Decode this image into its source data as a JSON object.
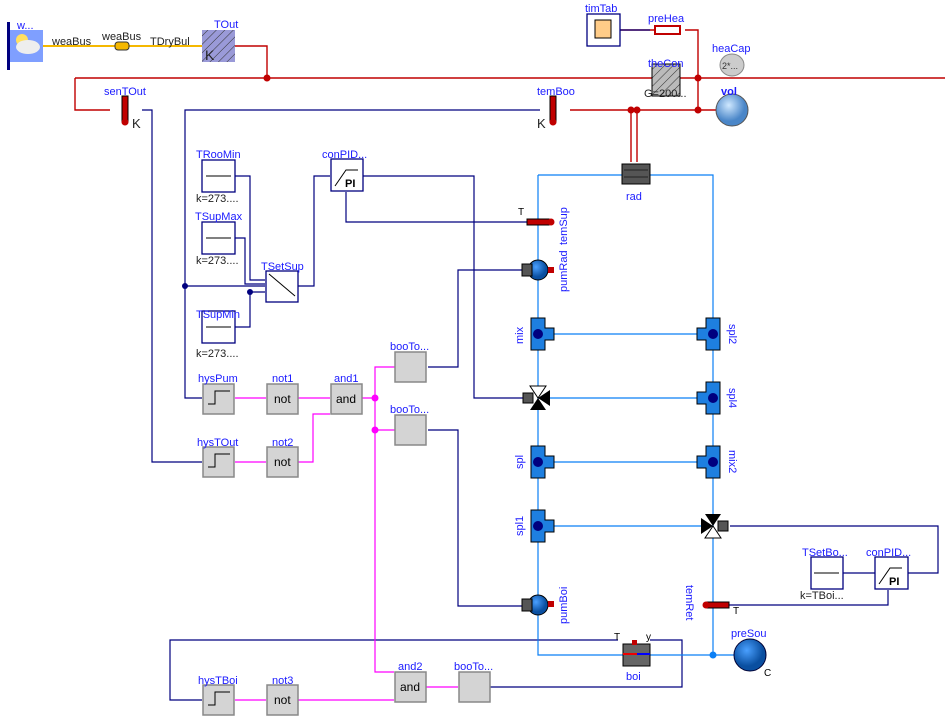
{
  "components": {
    "weaDat": {
      "label": "w..."
    },
    "weaBus_line": {
      "label": "weaBus"
    },
    "weaBus": {
      "label": "weaBus"
    },
    "TDryBul": {
      "label": "TDryBul"
    },
    "TOut": {
      "label": "TOut",
      "unit": "K"
    },
    "senTOut": {
      "label": "senTOut",
      "unit": "K"
    },
    "temBoo": {
      "label": "temBoo",
      "unit": "K"
    },
    "timTab": {
      "label": "timTab"
    },
    "preHea": {
      "label": "preHea"
    },
    "heaCap": {
      "label": "heaCap",
      "param": "2*..."
    },
    "theCon": {
      "label": "theCon",
      "param": "G=200..."
    },
    "vol": {
      "label": "vol"
    },
    "rad": {
      "label": "rad"
    },
    "TRooMin": {
      "label": "TRooMin",
      "param": "k=273...."
    },
    "TSupMax": {
      "label": "TSupMax",
      "param": "k=273...."
    },
    "TSupMin": {
      "label": "TSupMin",
      "param": "k=273...."
    },
    "TSetSup": {
      "label": "TSetSup"
    },
    "conPIDRad": {
      "label": "conPID...",
      "text": "PI"
    },
    "temSup": {
      "label": "temSup",
      "port": "T"
    },
    "pumRad": {
      "label": "pumRad"
    },
    "mix": {
      "label": "mix"
    },
    "spl2": {
      "label": "spl2"
    },
    "spl4": {
      "label": "spl4"
    },
    "spl": {
      "label": "spl"
    },
    "mix2": {
      "label": "mix2"
    },
    "spl1": {
      "label": "spl1"
    },
    "pumBoi": {
      "label": "pumBoi"
    },
    "temRet": {
      "label": "temRet",
      "port": "T"
    },
    "boi": {
      "label": "boi",
      "port_T": "T",
      "port_y": "y"
    },
    "preSou": {
      "label": "preSou",
      "port": "C"
    },
    "hysPum": {
      "label": "hysPum"
    },
    "hysTOut": {
      "label": "hysTOut"
    },
    "hysTBoi": {
      "label": "hysTBoi"
    },
    "not1": {
      "label": "not1",
      "text": "not"
    },
    "not2": {
      "label": "not2",
      "text": "not"
    },
    "not3": {
      "label": "not3",
      "text": "not"
    },
    "and1": {
      "label": "and1",
      "text": "and"
    },
    "and2": {
      "label": "and2",
      "text": "and"
    },
    "booToReaRad": {
      "label": "booTo..."
    },
    "booToReaVal": {
      "label": "booTo..."
    },
    "booToReaBoi": {
      "label": "booTo..."
    },
    "TSetBoiRet": {
      "label": "TSetBo...",
      "param": "k=TBoi..."
    },
    "conPIDBoi": {
      "label": "conPID...",
      "text": "PI"
    }
  },
  "colors": {
    "heat": "#c00000",
    "fluid": "#0a7ff5",
    "signal": "#00007f",
    "boolean": "#ff00ff",
    "bus": "#f5b800",
    "label": "#1a1aff"
  }
}
